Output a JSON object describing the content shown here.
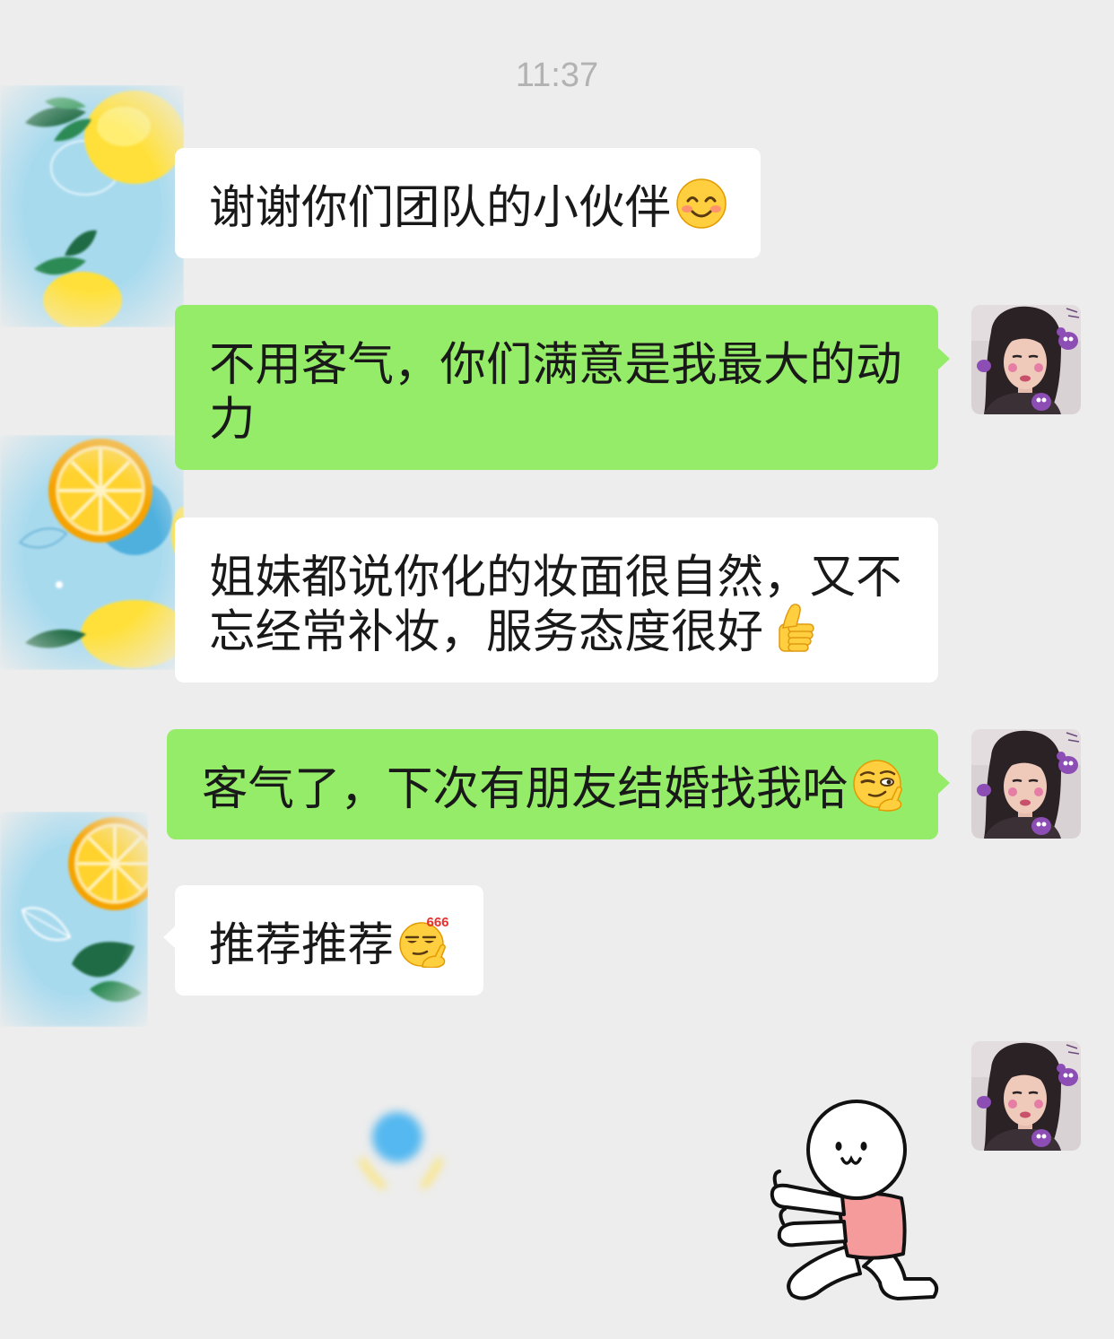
{
  "colors": {
    "background": "#ededed",
    "timestamp": "#b2b2b2",
    "sent_bubble": "#95ec69",
    "received_bubble": "#ffffff",
    "message_text": "#191919"
  },
  "timestamp": "11:37",
  "messages": [
    {
      "outgoing": false,
      "lines": [
        "谢谢你们团队的小伙伴"
      ],
      "emoji": "smiling-face-icon"
    },
    {
      "outgoing": true,
      "lines": [
        "不用客气，你们满意是我最大的动",
        "力"
      ]
    },
    {
      "outgoing": false,
      "lines": [
        "姐妹都说你化的妆面很自然，又不",
        "忘经常补妆，服务态度很好"
      ],
      "emoji": "thumbs-up-icon"
    },
    {
      "outgoing": true,
      "lines": [
        "客气了，下次有朋友结婚找我哈"
      ],
      "emoji": "smart-face-icon"
    },
    {
      "outgoing": false,
      "lines": [
        "推荐推荐"
      ],
      "emoji": "666-face-icon",
      "emoji_text": "666"
    },
    {
      "outgoing": true,
      "sticker": "kneeling-cartoon-sticker"
    }
  ]
}
